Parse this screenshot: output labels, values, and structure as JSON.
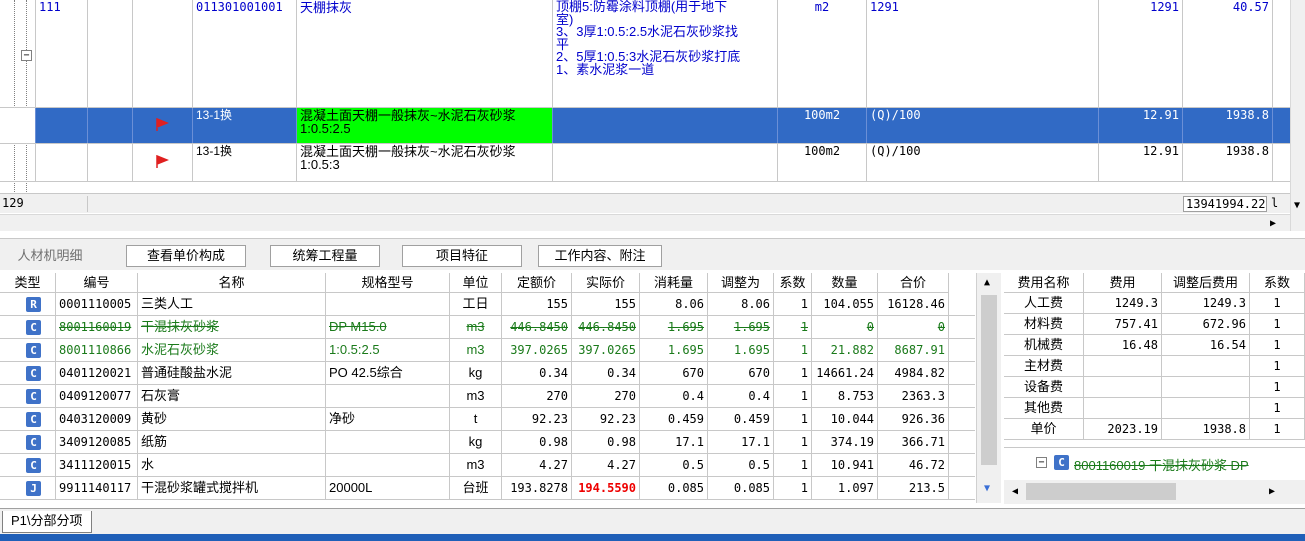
{
  "top_grid": {
    "rows": [
      {
        "seq": "111",
        "code": "011301001001",
        "name": "天棚抹灰",
        "feature": "顶棚5:防霉涂料顶棚(用于地下\n室)\n3、3厚1:0.5:2.5水泥石灰砂浆找\n平\n2、5厚1:0.5:3水泥石灰砂浆打底\n1、素水泥浆一道",
        "unit": "m2",
        "qty_expr": "1291",
        "qty": "1291",
        "price": "40.57"
      },
      {
        "code": "13-1换",
        "name": "混凝土面天棚一般抹灰~水泥石灰砂浆\n1:0.5:2.5",
        "unit": "100m2",
        "qty_expr": "(Q)/100",
        "qty": "12.91",
        "price": "1938.8"
      },
      {
        "code": "13-1换",
        "name": "混凝土面天棚一般抹灰~水泥石灰砂浆\n1:0.5:3",
        "unit": "100m2",
        "qty_expr": "(Q)/100",
        "qty": "12.91",
        "price": "1938.8"
      }
    ],
    "status_left": "129",
    "status_right": "13941994.22",
    "status_right_suffix": "l"
  },
  "tabs": [
    "人材机明细",
    "查看单价构成",
    "统筹工程量",
    "项目特征",
    "工作内容、附注"
  ],
  "detail": {
    "headers": [
      "类型",
      "编号",
      "名称",
      "规格型号",
      "单位",
      "定额价",
      "实际价",
      "消耗量",
      "调整为",
      "系数",
      "数量",
      "合价"
    ],
    "rows": [
      {
        "type": "R",
        "code": "0001110005",
        "name": "三类人工",
        "spec": "",
        "unit": "工日",
        "base": "155",
        "actual": "155",
        "consume": "8.06",
        "adjust": "8.06",
        "coef": "1",
        "qty": "104.055",
        "total": "16128.46",
        "style": "normal"
      },
      {
        "type": "C",
        "code": "8001160019",
        "name": "干混抹灰砂浆",
        "spec": "DP M15.0",
        "unit": "m3",
        "base": "446.8450",
        "actual": "446.8450",
        "consume": "1.695",
        "adjust": "1.695",
        "coef": "1",
        "qty": "0",
        "total": "0",
        "style": "strike"
      },
      {
        "type": "C",
        "code": "8001110866",
        "name": "水泥石灰砂浆",
        "spec": "1:0.5:2.5",
        "unit": "m3",
        "base": "397.0265",
        "actual": "397.0265",
        "consume": "1.695",
        "adjust": "1.695",
        "coef": "1",
        "qty": "21.882",
        "total": "8687.91",
        "style": "green"
      },
      {
        "type": "C",
        "code": "0401120021",
        "name": "普通硅酸盐水泥",
        "spec": "PO 42.5综合",
        "unit": "kg",
        "base": "0.34",
        "actual": "0.34",
        "consume": "670",
        "adjust": "670",
        "coef": "1",
        "qty": "14661.24",
        "total": "4984.82",
        "style": "normal"
      },
      {
        "type": "C",
        "code": "0409120077",
        "name": "石灰膏",
        "spec": "",
        "unit": "m3",
        "base": "270",
        "actual": "270",
        "consume": "0.4",
        "adjust": "0.4",
        "coef": "1",
        "qty": "8.753",
        "total": "2363.3",
        "style": "normal"
      },
      {
        "type": "C",
        "code": "0403120009",
        "name": "黄砂",
        "spec": "净砂",
        "unit": "t",
        "base": "92.23",
        "actual": "92.23",
        "consume": "0.459",
        "adjust": "0.459",
        "coef": "1",
        "qty": "10.044",
        "total": "926.36",
        "style": "normal"
      },
      {
        "type": "C",
        "code": "3409120085",
        "name": "纸筋",
        "spec": "",
        "unit": "kg",
        "base": "0.98",
        "actual": "0.98",
        "consume": "17.1",
        "adjust": "17.1",
        "coef": "1",
        "qty": "374.19",
        "total": "366.71",
        "style": "normal"
      },
      {
        "type": "C",
        "code": "3411120015",
        "name": "水",
        "spec": "",
        "unit": "m3",
        "base": "4.27",
        "actual": "4.27",
        "consume": "0.5",
        "adjust": "0.5",
        "coef": "1",
        "qty": "10.941",
        "total": "46.72",
        "style": "normal"
      },
      {
        "type": "J",
        "code": "9911140117",
        "name": "干混砂浆罐式搅拌机",
        "spec": "20000L",
        "unit": "台班",
        "base": "193.8278",
        "actual": "194.5590",
        "consume": "0.085",
        "adjust": "0.085",
        "coef": "1",
        "qty": "1.097",
        "total": "213.5",
        "style": "normal",
        "actual_red": true
      }
    ]
  },
  "fee": {
    "headers": [
      "费用名称",
      "费用",
      "调整后费用",
      "系数"
    ],
    "rows": [
      {
        "name": "人工费",
        "fee": "1249.3",
        "adj": "1249.3",
        "coef": "1"
      },
      {
        "name": "材料费",
        "fee": "757.41",
        "adj": "672.96",
        "coef": "1"
      },
      {
        "name": "机械费",
        "fee": "16.48",
        "adj": "16.54",
        "coef": "1"
      },
      {
        "name": "主材费",
        "fee": "",
        "adj": "",
        "coef": "1"
      },
      {
        "name": "设备费",
        "fee": "",
        "adj": "",
        "coef": "1"
      },
      {
        "name": "其他费",
        "fee": "",
        "adj": "",
        "coef": "1"
      },
      {
        "name": "单价",
        "fee": "2023.19",
        "adj": "1938.8",
        "coef": "1"
      }
    ],
    "tree_item": "8001160019 干混抹灰砂浆 DP"
  },
  "sheet_tab": "P1\\分部分项",
  "colors": {
    "selection": "#316ac5",
    "green_cell": "#00ff00",
    "badge": "#3f72c8",
    "strike_text": "#1a7a1a",
    "status_strip": "#1f5fb8"
  }
}
